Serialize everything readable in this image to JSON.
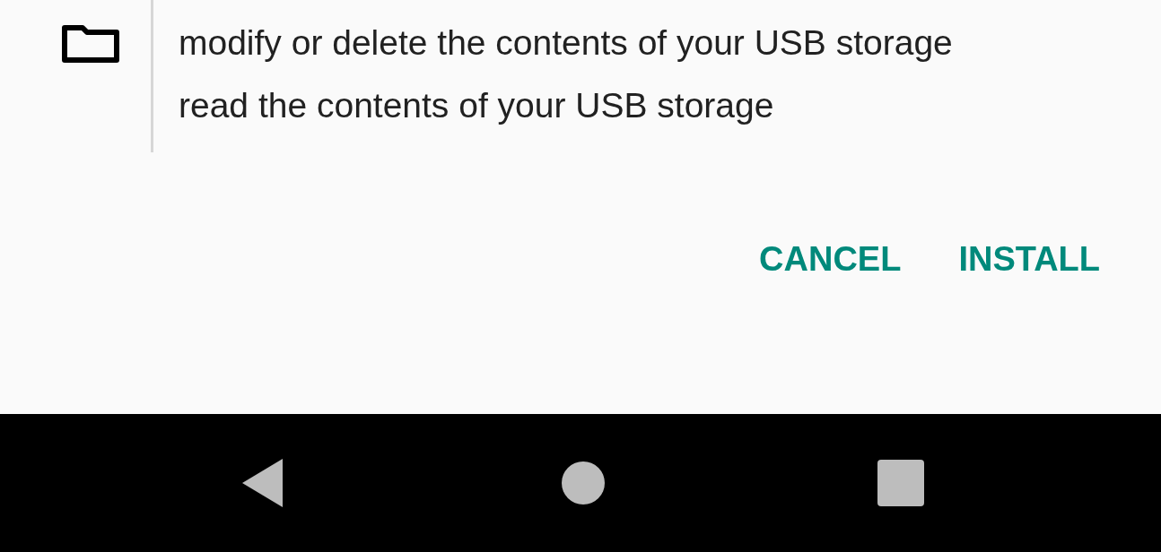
{
  "permissions": [
    {
      "text": "modify or delete the contents of your USB storage"
    },
    {
      "text": "read the contents of your USB storage"
    }
  ],
  "buttons": [
    {
      "label": "CANCEL"
    },
    {
      "label": "INSTALL"
    }
  ],
  "nav_bar": {
    "buttons": [
      {
        "kind": "back"
      },
      {
        "kind": "home"
      },
      {
        "kind": "recents"
      }
    ]
  }
}
